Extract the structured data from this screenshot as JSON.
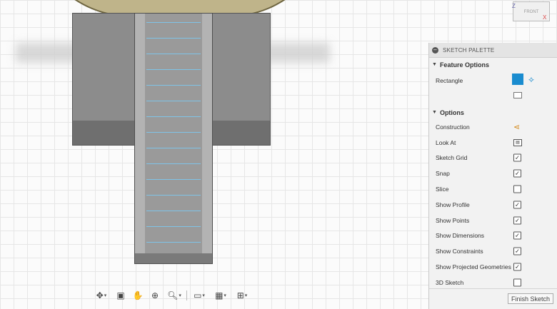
{
  "viewcube": {
    "face_label": "FRONT",
    "axis_x": "X",
    "axis_z": "Z"
  },
  "palette": {
    "title": "SKETCH PALETTE",
    "feature_options": {
      "header": "Feature Options",
      "rectangle_label": "Rectangle"
    },
    "options": {
      "header": "Options",
      "items": [
        {
          "label": "Construction",
          "control": "icon"
        },
        {
          "label": "Look At",
          "control": "icon"
        },
        {
          "label": "Sketch Grid",
          "control": "checkbox",
          "checked": true
        },
        {
          "label": "Snap",
          "control": "checkbox",
          "checked": true
        },
        {
          "label": "Slice",
          "control": "checkbox",
          "checked": false
        },
        {
          "label": "Show Profile",
          "control": "checkbox",
          "checked": true
        },
        {
          "label": "Show Points",
          "control": "checkbox",
          "checked": true
        },
        {
          "label": "Show Dimensions",
          "control": "checkbox",
          "checked": true
        },
        {
          "label": "Show Constraints",
          "control": "checkbox",
          "checked": true
        },
        {
          "label": "Show Projected Geometries",
          "control": "checkbox",
          "checked": true
        },
        {
          "label": "3D Sketch",
          "control": "checkbox",
          "checked": false
        }
      ]
    },
    "finish_label": "Finish Sketch"
  },
  "toolbar": {
    "tools": [
      "orbit-icon",
      "look-at-icon",
      "pan-icon",
      "zoom-window-icon",
      "zoom-icon",
      "display-settings-icon",
      "grid-settings-icon",
      "viewports-icon"
    ]
  },
  "colors": {
    "accent": "#1a8ccf",
    "construction": "#d38a1c"
  }
}
